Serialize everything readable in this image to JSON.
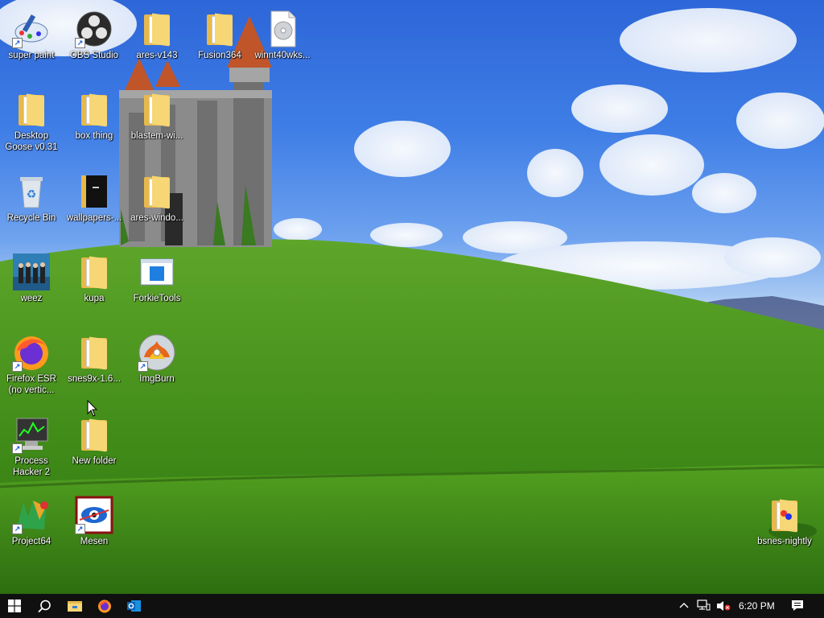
{
  "desktop": {
    "icons": [
      {
        "id": "super-paint",
        "label": "super paint",
        "shortcut": true
      },
      {
        "id": "obs-studio",
        "label": "OBS Studio",
        "shortcut": true
      },
      {
        "id": "ares-v143",
        "label": "ares-v143",
        "shortcut": false
      },
      {
        "id": "fusion364",
        "label": "Fusion364",
        "shortcut": false
      },
      {
        "id": "winnt40wks",
        "label": "winnt40wks...",
        "shortcut": false
      },
      {
        "id": "desktop-goose",
        "label": "Desktop Goose v0.31",
        "shortcut": false
      },
      {
        "id": "box-thing",
        "label": "box thing",
        "shortcut": false
      },
      {
        "id": "blastem",
        "label": "blastem-wi...",
        "shortcut": false
      },
      {
        "id": "recycle-bin",
        "label": "Recycle Bin",
        "shortcut": false
      },
      {
        "id": "wallpapers",
        "label": "wallpapers-...",
        "shortcut": false
      },
      {
        "id": "ares-windows",
        "label": "ares-windo...",
        "shortcut": false
      },
      {
        "id": "weez",
        "label": "weez",
        "shortcut": false
      },
      {
        "id": "kupa",
        "label": "kupa",
        "shortcut": false
      },
      {
        "id": "forkietools",
        "label": "ForkieTools",
        "shortcut": false
      },
      {
        "id": "firefox-esr",
        "label": "Firefox ESR (no vertic...",
        "shortcut": true
      },
      {
        "id": "snes9x",
        "label": "snes9x-1.6...",
        "shortcut": false
      },
      {
        "id": "imgburn",
        "label": "ImgBurn",
        "shortcut": true
      },
      {
        "id": "process-hacker",
        "label": "Process Hacker 2",
        "shortcut": true
      },
      {
        "id": "new-folder",
        "label": "New folder",
        "shortcut": false
      },
      {
        "id": "project64",
        "label": "Project64",
        "shortcut": true
      },
      {
        "id": "mesen",
        "label": "Mesen",
        "shortcut": true
      },
      {
        "id": "bsnes-nightly",
        "label": "bsnes-nightly",
        "shortcut": false
      }
    ]
  },
  "taskbar": {
    "clock": "6:20 PM",
    "pinned": [
      "start-icon",
      "search-icon",
      "file-explorer-icon",
      "firefox-icon",
      "outlook-icon"
    ],
    "tray": [
      "chevron-up-icon",
      "network-icon",
      "volume-muted-icon",
      "notifications-icon"
    ]
  },
  "colors": {
    "taskbar_bg": "#101010",
    "sky_blue": "#2d66d8",
    "grass_green": "#4f9a1e",
    "folder_yellow": "#f6d675"
  }
}
